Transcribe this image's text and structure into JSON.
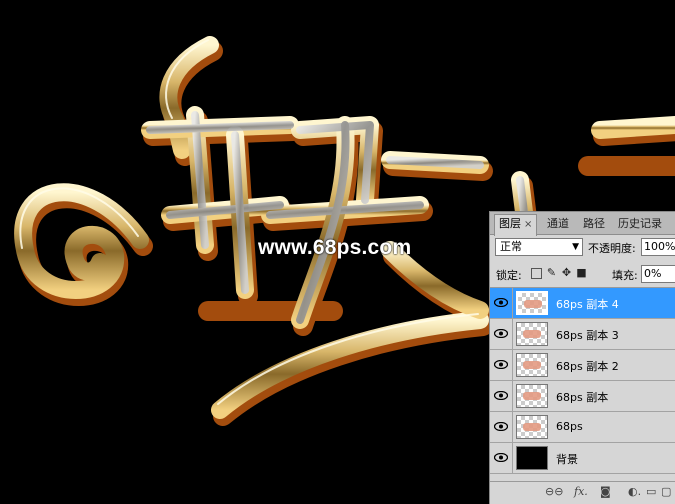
{
  "watermark": "www.68ps.com",
  "layers_panel": {
    "tabs": [
      {
        "label": "图层",
        "close": "×",
        "active": true
      },
      {
        "label": "通道"
      },
      {
        "label": "路径"
      },
      {
        "label": "历史记录"
      }
    ],
    "blend_mode": "正常",
    "opacity_label": "不透明度:",
    "opacity_value": "100%",
    "lock_label": "锁定:",
    "fill_label": "填充:",
    "fill_value": "0%",
    "layers": [
      {
        "name": "68ps 副本 4",
        "selected": true
      },
      {
        "name": "68ps 副本 3"
      },
      {
        "name": "68ps 副本 2"
      },
      {
        "name": "68ps 副本"
      },
      {
        "name": "68ps"
      },
      {
        "name": "背景",
        "background": true
      }
    ],
    "footer_icons": [
      "link-icon",
      "fx-icon",
      "mask-icon",
      "adjustment-icon",
      "group-icon",
      "new-layer-icon"
    ],
    "footer_fx": "fx."
  },
  "colors": {
    "selection": "#3399ff",
    "panel": "#d6d6d6",
    "canvas": "#000000"
  }
}
